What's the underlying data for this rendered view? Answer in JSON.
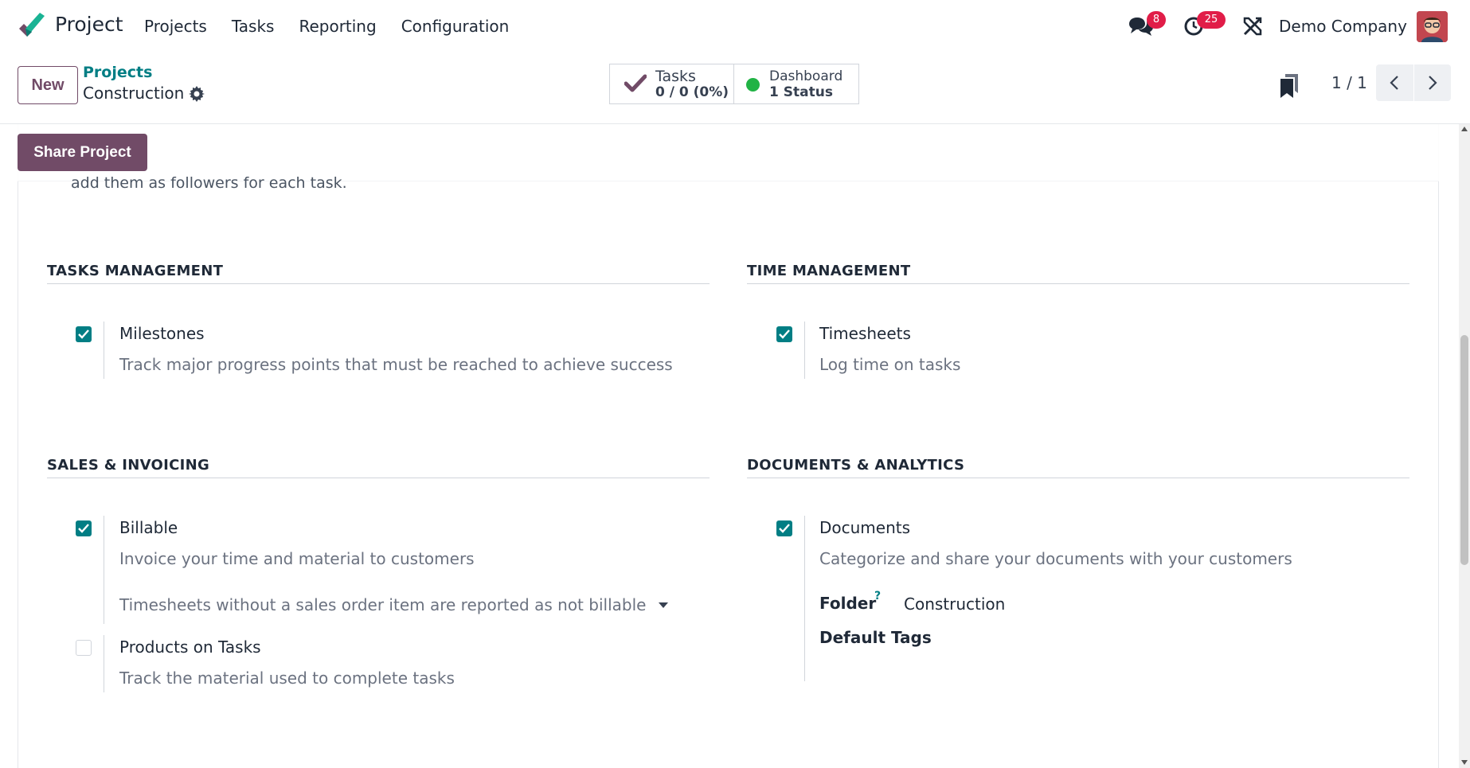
{
  "navbar": {
    "app_name": "Project",
    "menu": [
      "Projects",
      "Tasks",
      "Reporting",
      "Configuration"
    ],
    "messages_badge": "8",
    "activities_badge": "25",
    "company": "Demo Company"
  },
  "control": {
    "new_label": "New",
    "breadcrumb_parent": "Projects",
    "breadcrumb_current": "Construction",
    "smart_buttons": {
      "tasks_label": "Tasks",
      "tasks_value": "0 / 0 (0%)",
      "dashboard_label": "Dashboard",
      "dashboard_value": "1 Status"
    },
    "pager": "1 / 1"
  },
  "form": {
    "share_label": "Share Project",
    "clipped_text": "add them as followers for each task.",
    "sections": {
      "tasks_management": {
        "title": "TASKS MANAGEMENT",
        "milestones": {
          "title": "Milestones",
          "desc": "Track major progress points that must be reached to achieve success",
          "checked": true
        }
      },
      "time_management": {
        "title": "TIME MANAGEMENT",
        "timesheets": {
          "title": "Timesheets",
          "desc": "Log time on tasks",
          "checked": true
        }
      },
      "sales_invoicing": {
        "title": "SALES & INVOICING",
        "billable": {
          "title": "Billable",
          "desc": "Invoice your time and material to customers",
          "checked": true
        },
        "billable_select": "Timesheets without a sales order item are reported as not billable",
        "products": {
          "title": "Products on Tasks",
          "desc": "Track the material used to complete tasks",
          "checked": false
        }
      },
      "documents_analytics": {
        "title": "DOCUMENTS & ANALYTICS",
        "documents": {
          "title": "Documents",
          "desc": "Categorize and share your documents with your customers",
          "checked": true
        },
        "folder_label": "Folder",
        "folder_help": "?",
        "folder_value": "Construction",
        "tags_label": "Default Tags"
      }
    }
  },
  "colors": {
    "brand": "#714b67",
    "accent": "#017e84",
    "badge": "#e11d48",
    "status_green": "#21b345"
  }
}
